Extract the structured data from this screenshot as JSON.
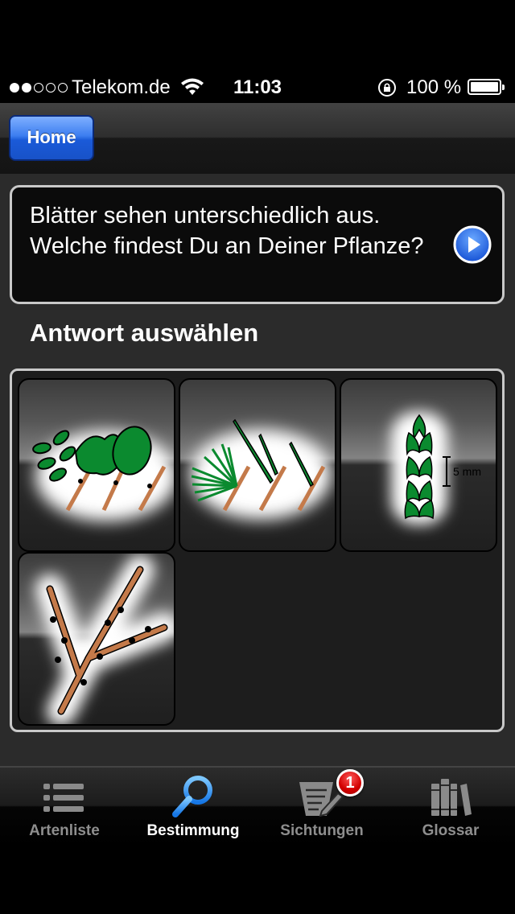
{
  "status_bar": {
    "carrier": "Telekom.de",
    "time": "11:03",
    "battery": "100 %",
    "signal_bars": 2,
    "signal_total": 5,
    "icons": [
      "wifi-icon",
      "rotation-lock-icon",
      "battery-icon"
    ]
  },
  "nav": {
    "home_label": "Home"
  },
  "question": {
    "text": "Blätter sehen unterschiedlich aus. Welche findest Du an Deiner Pflanze?",
    "icon": "play-icon"
  },
  "answers": {
    "title": "Antwort auswählen",
    "options": [
      {
        "icon": "broad-leaves-icon"
      },
      {
        "icon": "needle-leaves-icon"
      },
      {
        "icon": "scale-leaves-icon",
        "scale_label": "5 mm"
      },
      {
        "icon": "bare-twig-icon"
      }
    ]
  },
  "tabbar": {
    "active": "Bestimmung",
    "tabs": [
      {
        "label": "Artenliste",
        "icon": "list-icon"
      },
      {
        "label": "Bestimmung",
        "icon": "magnifier-icon"
      },
      {
        "label": "Sichtungen",
        "icon": "notepad-pen-icon",
        "badge": "1"
      },
      {
        "label": "Glossar",
        "icon": "books-icon"
      }
    ]
  },
  "colors": {
    "accent_blue": "#2b6fe8",
    "leaf_green": "#0b8a2f",
    "stem_brown": "#c47a4a",
    "badge_red": "#d20000"
  }
}
